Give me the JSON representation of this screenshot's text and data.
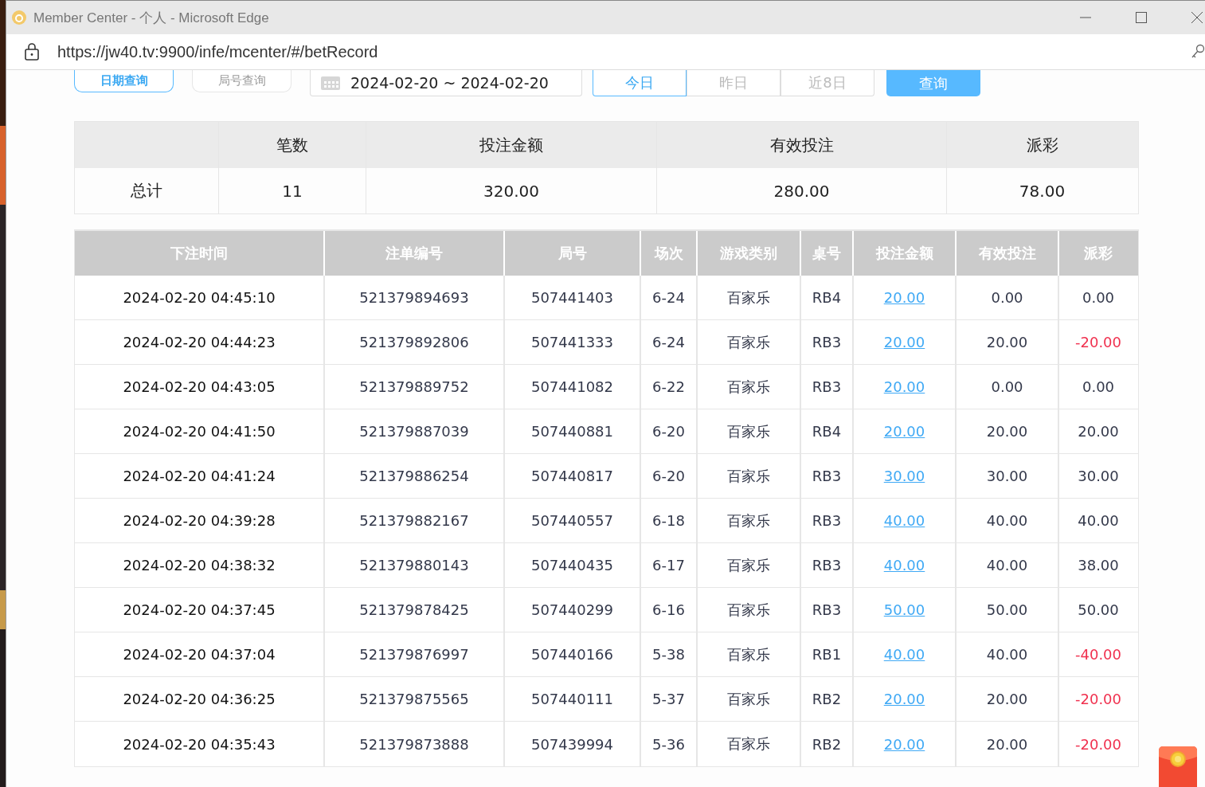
{
  "window": {
    "title": "Member Center - 个人 - Microsoft Edge"
  },
  "address_bar": {
    "url": "https://jw40.tv:9900/infe/mcenter/#/betRecord"
  },
  "query_tabs": [
    {
      "label": "日期查询",
      "selected": true
    },
    {
      "label": "局号查询",
      "selected": false
    }
  ],
  "date_range": {
    "value": "2024-02-20 ~ 2024-02-20"
  },
  "quick_ranges": [
    {
      "label": "今日",
      "selected": true
    },
    {
      "label": "昨日",
      "selected": false
    },
    {
      "label": "近8日",
      "selected": false
    }
  ],
  "search_button": "查询",
  "summary": {
    "columns": [
      "笔数",
      "投注金额",
      "有效投注",
      "派彩"
    ],
    "row_label": "总计",
    "values": [
      "11",
      "320.00",
      "280.00",
      "78.00"
    ]
  },
  "table": {
    "columns": [
      "下注时间",
      "注单编号",
      "局号",
      "场次",
      "游戏类别",
      "桌号",
      "投注金额",
      "有效投注",
      "派彩"
    ],
    "rows": [
      {
        "time": "2024-02-20 04:45:10",
        "order": "521379894693",
        "round": "507441403",
        "session": "6-24",
        "game": "百家乐",
        "table": "RB4",
        "amount": "20.00",
        "valid": "0.00",
        "payout": "0.00",
        "loss": false
      },
      {
        "time": "2024-02-20 04:44:23",
        "order": "521379892806",
        "round": "507441333",
        "session": "6-24",
        "game": "百家乐",
        "table": "RB3",
        "amount": "20.00",
        "valid": "20.00",
        "payout": "-20.00",
        "loss": true
      },
      {
        "time": "2024-02-20 04:43:05",
        "order": "521379889752",
        "round": "507441082",
        "session": "6-22",
        "game": "百家乐",
        "table": "RB3",
        "amount": "20.00",
        "valid": "0.00",
        "payout": "0.00",
        "loss": false
      },
      {
        "time": "2024-02-20 04:41:50",
        "order": "521379887039",
        "round": "507440881",
        "session": "6-20",
        "game": "百家乐",
        "table": "RB4",
        "amount": "20.00",
        "valid": "20.00",
        "payout": "20.00",
        "loss": false
      },
      {
        "time": "2024-02-20 04:41:24",
        "order": "521379886254",
        "round": "507440817",
        "session": "6-20",
        "game": "百家乐",
        "table": "RB3",
        "amount": "30.00",
        "valid": "30.00",
        "payout": "30.00",
        "loss": false
      },
      {
        "time": "2024-02-20 04:39:28",
        "order": "521379882167",
        "round": "507440557",
        "session": "6-18",
        "game": "百家乐",
        "table": "RB3",
        "amount": "40.00",
        "valid": "40.00",
        "payout": "40.00",
        "loss": false
      },
      {
        "time": "2024-02-20 04:38:32",
        "order": "521379880143",
        "round": "507440435",
        "session": "6-17",
        "game": "百家乐",
        "table": "RB3",
        "amount": "40.00",
        "valid": "40.00",
        "payout": "38.00",
        "loss": false
      },
      {
        "time": "2024-02-20 04:37:45",
        "order": "521379878425",
        "round": "507440299",
        "session": "6-16",
        "game": "百家乐",
        "table": "RB3",
        "amount": "50.00",
        "valid": "50.00",
        "payout": "50.00",
        "loss": false
      },
      {
        "time": "2024-02-20 04:37:04",
        "order": "521379876997",
        "round": "507440166",
        "session": "5-38",
        "game": "百家乐",
        "table": "RB1",
        "amount": "40.00",
        "valid": "40.00",
        "payout": "-40.00",
        "loss": true
      },
      {
        "time": "2024-02-20 04:36:25",
        "order": "521379875565",
        "round": "507440111",
        "session": "5-37",
        "game": "百家乐",
        "table": "RB2",
        "amount": "20.00",
        "valid": "20.00",
        "payout": "-20.00",
        "loss": true
      },
      {
        "time": "2024-02-20 04:35:43",
        "order": "521379873888",
        "round": "507439994",
        "session": "5-36",
        "game": "百家乐",
        "table": "RB2",
        "amount": "20.00",
        "valid": "20.00",
        "payout": "-20.00",
        "loss": true
      }
    ]
  }
}
